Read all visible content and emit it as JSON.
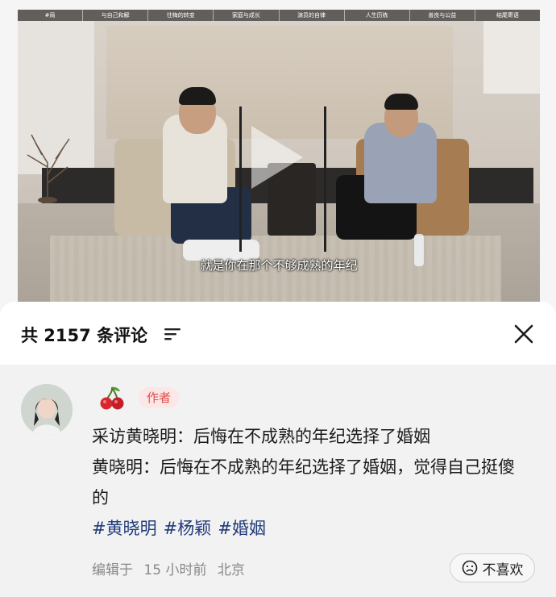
{
  "video": {
    "chapters": [
      "#局",
      "与自己和解",
      "往梅的转变",
      "家庭与成长",
      "演员的自律",
      "人生历练",
      "善良与公益",
      "结尾寄语"
    ],
    "subtitle": "就是你在那个不够成熟的年纪"
  },
  "comments_sheet": {
    "title": "共 2157 条评论",
    "close_icon": "close-icon",
    "sort_icon": "sort-icon"
  },
  "comment": {
    "avatar_icon": "avatar",
    "username_icon": "cherry-icon",
    "badge": "作者",
    "line1": "采访黄晓明：后悔在不成熟的年纪选择了婚姻",
    "line2": "黄晓明：后悔在不成熟的年纪选择了婚姻，觉得自己挺傻的",
    "hashtags": [
      "#黄晓明",
      "#杨颖",
      "#婚姻"
    ],
    "edited_label": "编辑于",
    "time": "15 小时前",
    "location": "北京",
    "dislike_label": "不喜欢"
  },
  "colors": {
    "badge_bg": "#fde6e6",
    "badge_text": "#e04b4b",
    "hashtag": "#1f3a7a",
    "sheet_bg": "#f2f2f2"
  }
}
